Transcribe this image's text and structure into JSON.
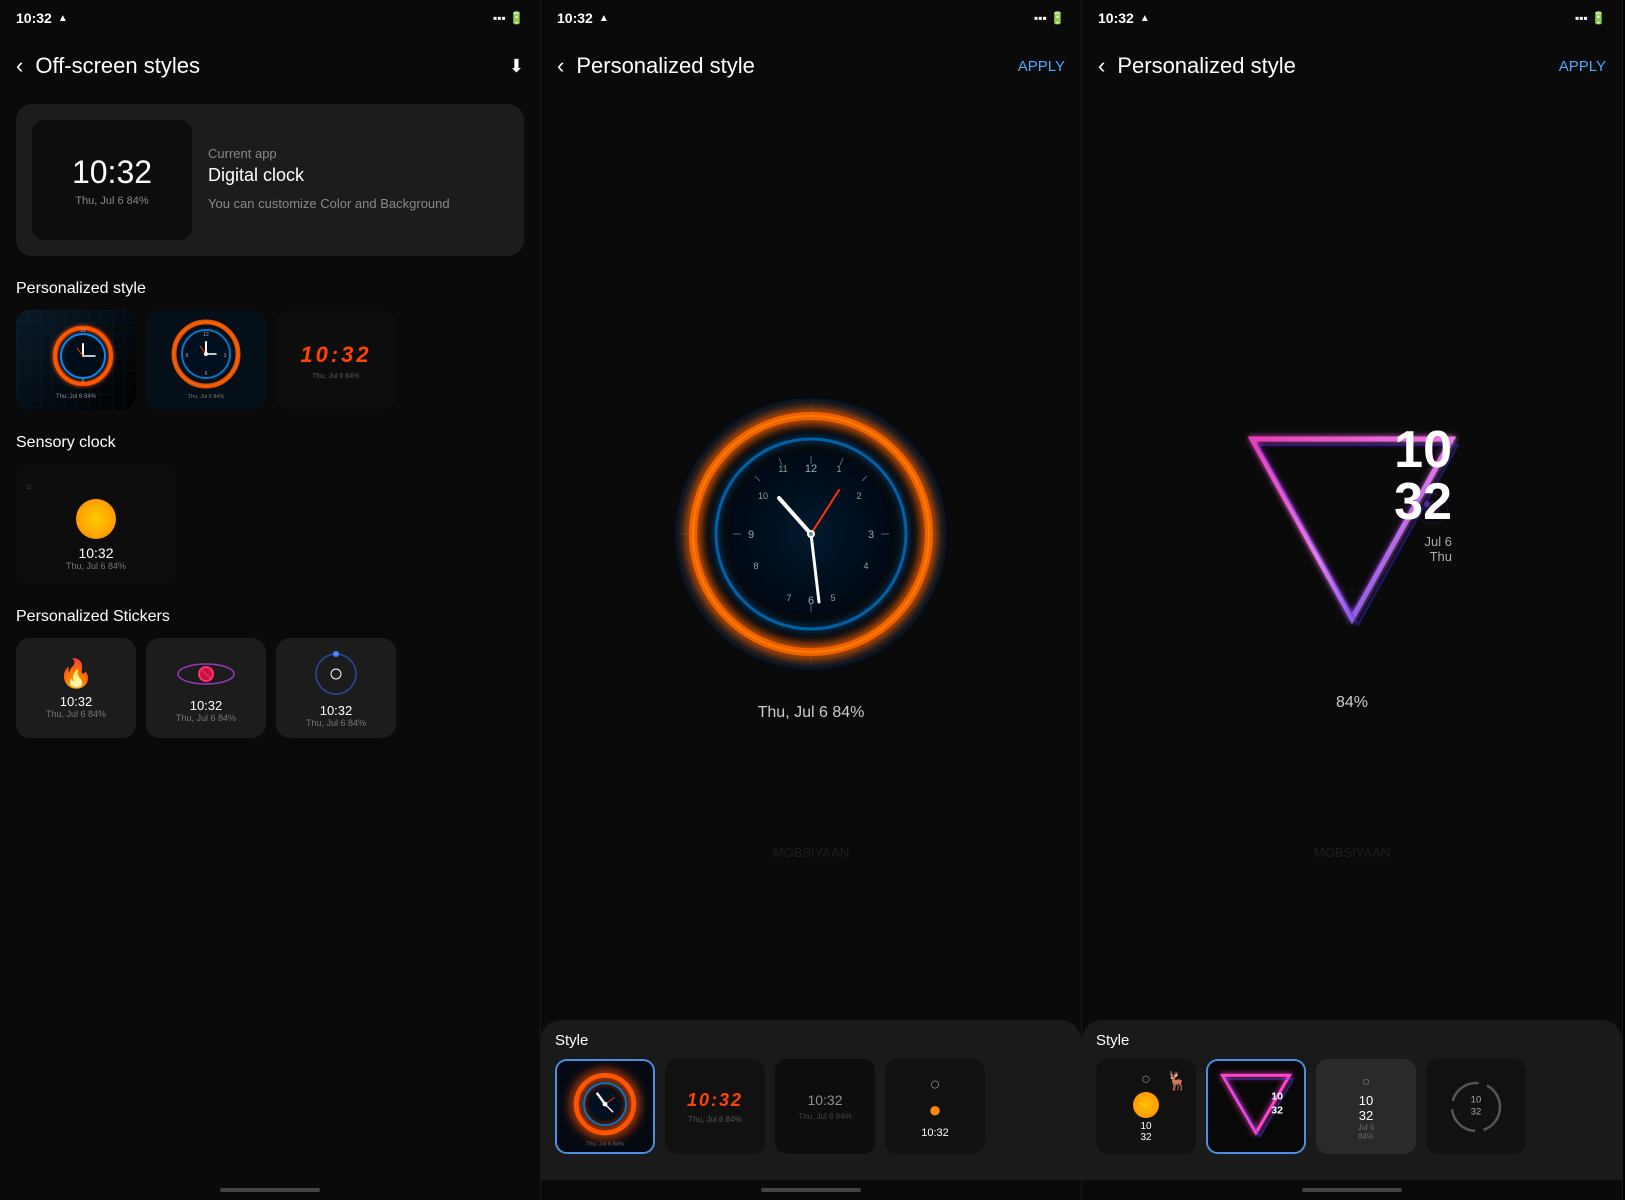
{
  "panel1": {
    "statusBar": {
      "time": "10:32",
      "alertIcon": "▲",
      "batteryIcon": "🔋"
    },
    "header": {
      "title": "Off-screen styles",
      "downloadIcon": "⬇"
    },
    "currentApp": {
      "previewTime": "10:32",
      "previewDate": "Thu, Jul 6  84%",
      "label": "Current app",
      "name": "Digital clock",
      "description": "You can customize Color and Background"
    },
    "personalizedStyle": {
      "sectionTitle": "Personalized style"
    },
    "sensoryClock": {
      "sectionTitle": "Sensory clock",
      "time": "10:32",
      "date": "Thu, Jul 6  84%"
    },
    "personalizedStickers": {
      "sectionTitle": "Personalized Stickers",
      "items": [
        {
          "time": "10:32",
          "date": "Thu, Jul 6  84%",
          "type": "flame"
        },
        {
          "time": "10:32",
          "date": "Thu, Jul 6  84%",
          "type": "planet"
        },
        {
          "time": "10:32",
          "date": "Thu, Jul 6  84%",
          "type": "dot"
        }
      ]
    }
  },
  "panel2": {
    "statusBar": {
      "time": "10:32",
      "alertIcon": "▲",
      "batteryIcon": "🔋"
    },
    "header": {
      "title": "Personalized style",
      "applyLabel": "APPLY"
    },
    "preview": {
      "info": "Thu, Jul 6  84%"
    },
    "watermark": "MOBSIYAAN",
    "shelf": {
      "label": "Style",
      "items": [
        {
          "type": "neon-ring",
          "selected": true
        },
        {
          "type": "digital-red",
          "selected": false
        },
        {
          "type": "ghost-digital",
          "selected": false
        },
        {
          "type": "sensory-partial",
          "selected": false
        }
      ]
    }
  },
  "panel3": {
    "statusBar": {
      "time": "10:32",
      "alertIcon": "▲",
      "batteryIcon": "🔋"
    },
    "header": {
      "title": "Personalized style",
      "applyLabel": "APPLY"
    },
    "preview": {
      "hour": "10",
      "minute": "32",
      "date": "Jul 6",
      "day": "Thu",
      "battery": "84%"
    },
    "watermark": "MOBSIYAAN",
    "shelf": {
      "label": "Style",
      "items": [
        {
          "type": "sensory-sun",
          "selected": false
        },
        {
          "type": "triangle",
          "selected": true
        },
        {
          "type": "simple-digital",
          "selected": false
        },
        {
          "type": "minimal-ring",
          "selected": false
        }
      ]
    }
  }
}
